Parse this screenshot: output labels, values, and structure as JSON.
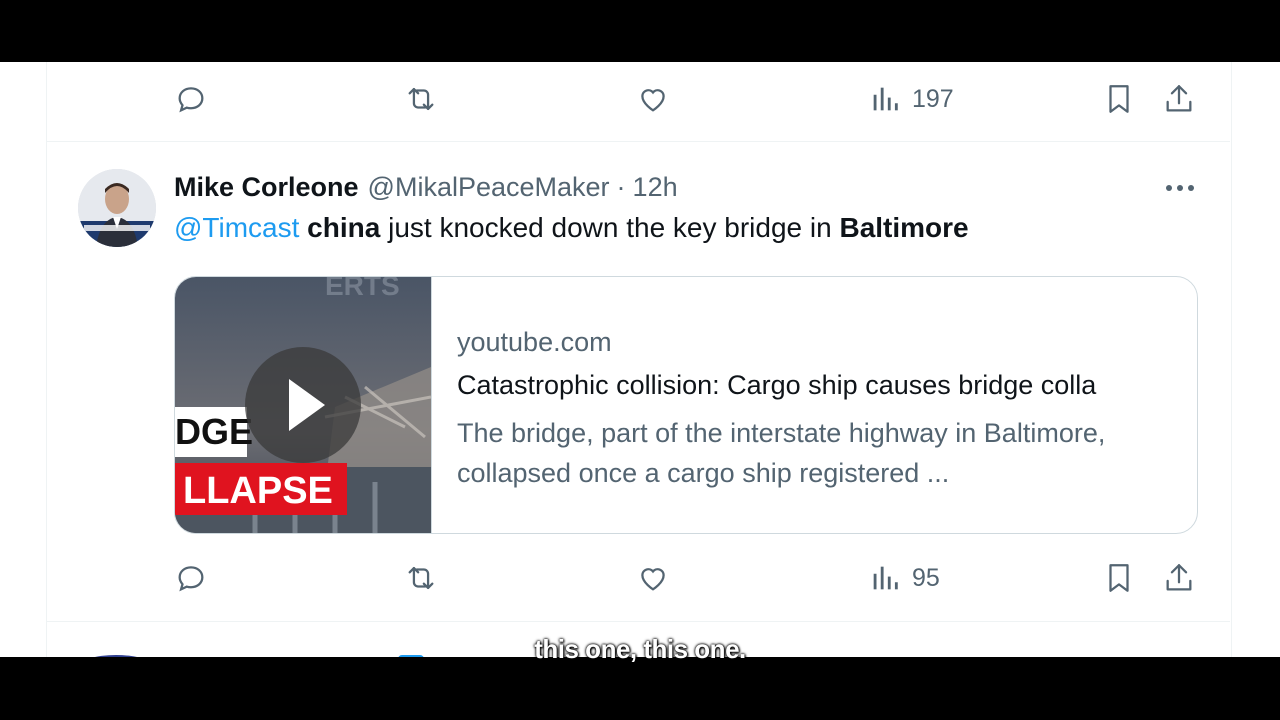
{
  "top_actions": {
    "views_count": "197"
  },
  "tweet": {
    "author_name": "Mike Corleone",
    "handle": "@MikalPeaceMaker",
    "separator": "·",
    "time": "12h",
    "text_parts": {
      "mention": "@Timcast",
      "word1": "china",
      "middle": " just knocked down the key bridge in ",
      "word2": "Baltimore"
    },
    "card": {
      "thumb_text_top": "DGE",
      "thumb_text_banner": "LLAPSE",
      "thumb_text_watermark": "ERTS",
      "domain": "youtube.com",
      "title": "Catastrophic collision: Cargo ship causes bridge colla",
      "description": "The bridge, part of the interstate highway in Baltimore, collapsed once a cargo ship registered ..."
    },
    "actions": {
      "views_count": "95"
    }
  },
  "caption": "this one, this one.",
  "icons": [
    "reply-icon",
    "retweet-icon",
    "like-icon",
    "views-icon",
    "bookmark-icon",
    "share-icon",
    "more-icon",
    "play-icon"
  ],
  "colors": {
    "accent": "#1d9bf0",
    "muted": "#536471",
    "text": "#0f1419",
    "banner_red": "#e0131f"
  }
}
